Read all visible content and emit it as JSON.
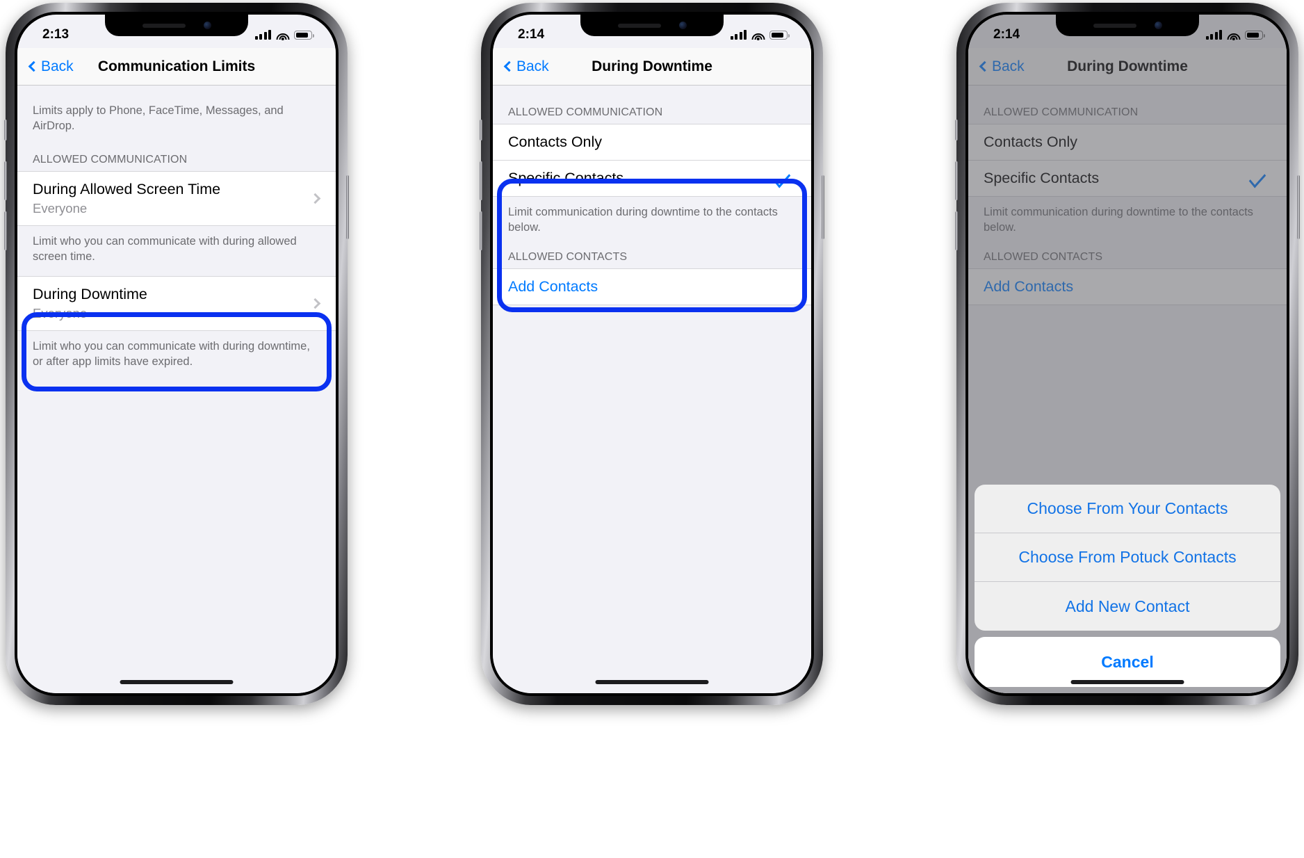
{
  "phones": [
    {
      "id": "phone-1",
      "status": {
        "time": "2:13",
        "signal_icon": "cellular-bars-icon",
        "wifi_icon": "wifi-icon",
        "battery_icon": "battery-icon"
      },
      "nav": {
        "back_label": "Back",
        "title": "Communication Limits",
        "back_icon": "chevron-left-icon"
      },
      "intro_note": "Limits apply to Phone, FaceTime, Messages, and AirDrop.",
      "section_header": "ALLOWED COMMUNICATION",
      "rows": [
        {
          "title": "During Allowed Screen Time",
          "value": "Everyone",
          "accessory": "chevron-right-icon"
        },
        {
          "title": "During Downtime",
          "value": "Everyone",
          "accessory": "chevron-right-icon"
        }
      ],
      "notes": [
        "Limit who you can communicate with during allowed screen time.",
        "Limit who you can communicate with during downtime, or after app limits have expired."
      ],
      "highlight_color": "#0a31f0"
    },
    {
      "id": "phone-2",
      "status": {
        "time": "2:14",
        "signal_icon": "cellular-bars-icon",
        "wifi_icon": "wifi-icon",
        "battery_icon": "battery-icon"
      },
      "nav": {
        "back_label": "Back",
        "title": "During Downtime",
        "back_icon": "chevron-left-icon"
      },
      "section_header": "ALLOWED COMMUNICATION",
      "options": [
        {
          "label": "Contacts Only",
          "selected": false
        },
        {
          "label": "Specific Contacts",
          "selected": true,
          "check_icon": "checkmark-icon"
        }
      ],
      "note": "Limit communication during downtime to the contacts below.",
      "contacts_header": "ALLOWED CONTACTS",
      "add_contacts_label": "Add Contacts",
      "highlight_color": "#0a31f0"
    },
    {
      "id": "phone-3",
      "status": {
        "time": "2:14",
        "signal_icon": "cellular-bars-icon",
        "wifi_icon": "wifi-icon",
        "battery_icon": "battery-icon"
      },
      "nav": {
        "back_label": "Back",
        "title": "During Downtime",
        "back_icon": "chevron-left-icon"
      },
      "section_header": "ALLOWED COMMUNICATION",
      "options": [
        {
          "label": "Contacts Only",
          "selected": false
        },
        {
          "label": "Specific Contacts",
          "selected": true,
          "check_icon": "checkmark-icon"
        }
      ],
      "note": "Limit communication during downtime to the contacts below.",
      "contacts_header": "ALLOWED CONTACTS",
      "add_contacts_label": "Add Contacts",
      "action_sheet": {
        "items": [
          "Choose From Your Contacts",
          "Choose From Potuck Contacts",
          "Add New Contact"
        ],
        "cancel_label": "Cancel"
      }
    }
  ],
  "colors": {
    "accent_blue": "#007aff",
    "sheet_blue": "#1273e6",
    "highlight_blue": "#0a31f0",
    "group_background": "#f2f2f7",
    "cell_background": "#ffffff",
    "secondary_text": "#6c6c70",
    "value_text": "#8e8e93"
  }
}
